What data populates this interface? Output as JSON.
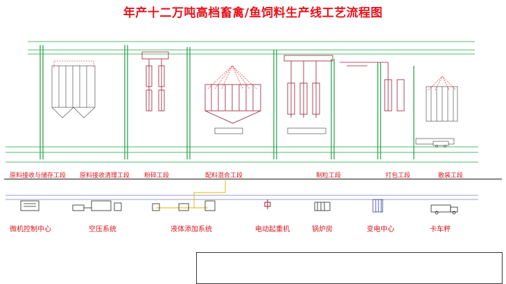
{
  "title": "年产十二万吨高档畜禽/鱼饲料生产线工艺流程图",
  "sections": [
    "原料接收与储存工段",
    "原料接收清理工段",
    "粉碎工段",
    "配料混合工段",
    "制粒工段",
    "打包工段",
    "散装工段"
  ],
  "equipment": [
    {
      "label": "微机控制中心",
      "icon": "control-cabinet-icon"
    },
    {
      "label": "空压系统",
      "icon": "air-compressor-icon"
    },
    {
      "label": "液体添加系统",
      "icon": "liquid-tank-icon"
    },
    {
      "label": "电动起重机",
      "icon": "crane-icon"
    },
    {
      "label": "锅炉房",
      "icon": "boiler-icon"
    },
    {
      "label": "变电中心",
      "icon": "substation-icon"
    },
    {
      "label": "卡车秤",
      "icon": "truck-scale-icon"
    }
  ],
  "colors": {
    "title": "#e8121a",
    "structure": "#19a13d",
    "equipment": "#9a1a35",
    "labels": "#d8161c",
    "liquid_line": "#e6b400",
    "utility": "#2a3b9a"
  }
}
